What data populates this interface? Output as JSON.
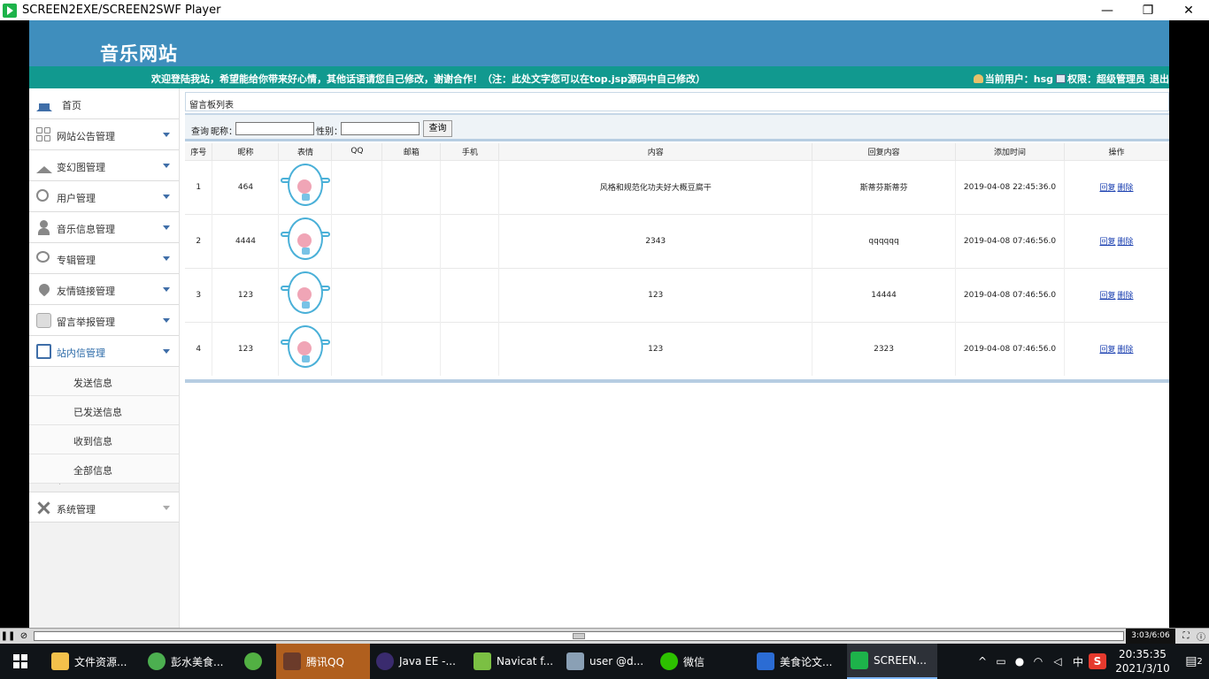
{
  "window": {
    "title": "SCREEN2EXE/SCREEN2SWF Player",
    "minimize_label": "—",
    "restore_label": "❐",
    "close_label": "✕"
  },
  "site": {
    "title": "音乐网站",
    "welcome": "欢迎登陆我站，希望能给你带来好心情，其他话语请您自己修改，谢谢合作！（注：此处文字您可以在top.jsp源码中自己修改）",
    "current_user_label": "当前用户：hsg",
    "permission_label": "权限：超级管理员",
    "logout_label": "退出",
    "header_color": "#3f8ebd",
    "bar_color": "#11998f"
  },
  "sidebar": {
    "items": [
      {
        "label": "首页",
        "icon": "home-icon"
      },
      {
        "label": "网站公告管理",
        "icon": "grid-icon"
      },
      {
        "label": "变幻图管理",
        "icon": "house-icon"
      },
      {
        "label": "用户管理",
        "icon": "users-icon"
      },
      {
        "label": "音乐信息管理",
        "icon": "person-icon"
      },
      {
        "label": "专辑管理",
        "icon": "chat-icon"
      },
      {
        "label": "友情链接管理",
        "icon": "heart-icon"
      },
      {
        "label": "留言举报管理",
        "icon": "group-icon"
      },
      {
        "label": "站内信管理",
        "icon": "doc-icon"
      }
    ],
    "sub_items": [
      {
        "label": "发送信息"
      },
      {
        "label": "已发送信息"
      },
      {
        "label": "收到信息"
      },
      {
        "label": "全部信息"
      }
    ],
    "system": {
      "label": "系统管理",
      "icon": "tools-icon"
    }
  },
  "main": {
    "panel_title": "留言板列表",
    "search": {
      "query_label": "查询",
      "nickname_label": "昵称：",
      "nickname_value": "",
      "gender_label": "性别：",
      "gender_value": "",
      "button_label": "查询"
    },
    "columns": [
      "序号",
      "昵称",
      "表情",
      "QQ",
      "邮箱",
      "手机",
      "内容",
      "回复内容",
      "添加时间",
      "操作"
    ],
    "rows": [
      {
        "no": "1",
        "nickname": "464",
        "qq": "",
        "email": "",
        "phone": "",
        "content": "风格和规范化功夫好大概豆腐干",
        "reply": "斯蒂芬斯蒂芬",
        "time": "2019-04-08 22:45:36.0",
        "reply_link": "回复",
        "delete_link": "删除"
      },
      {
        "no": "2",
        "nickname": "4444",
        "qq": "",
        "email": "",
        "phone": "",
        "content": "2343",
        "reply": "qqqqqq",
        "time": "2019-04-08 07:46:56.0",
        "reply_link": "回复",
        "delete_link": "删除"
      },
      {
        "no": "3",
        "nickname": "123",
        "qq": "",
        "email": "",
        "phone": "",
        "content": "123",
        "reply": "14444",
        "time": "2019-04-08 07:46:56.0",
        "reply_link": "回复",
        "delete_link": "删除"
      },
      {
        "no": "4",
        "nickname": "123",
        "qq": "",
        "email": "",
        "phone": "",
        "content": "123",
        "reply": "2323",
        "time": "2019-04-08 07:46:56.0",
        "reply_link": "回复",
        "delete_link": "删除"
      }
    ]
  },
  "player": {
    "time": "3:03/6:06",
    "progress": 0.5
  },
  "taskbar": {
    "items": [
      {
        "label": "文件资源...",
        "color": "#f3c04b"
      },
      {
        "label": "彭水美食...",
        "color": "#4caf50"
      },
      {
        "label": "",
        "color": "#52b043"
      },
      {
        "label": "腾讯QQ",
        "color": "#6b3b2a"
      },
      {
        "label": "Java EE -...",
        "color": "#3a2b6e"
      },
      {
        "label": "Navicat f...",
        "color": "#7bc043"
      },
      {
        "label": "user @d...",
        "color": "#8aa0b5"
      },
      {
        "label": "微信",
        "color": "#2dc100"
      },
      {
        "label": "美食论文...",
        "color": "#2b6cd4"
      },
      {
        "label": "SCREEN...",
        "color": "#1db34a"
      }
    ],
    "tray_ime": "中",
    "tray_app": "S",
    "clock_time": "20:35:35",
    "clock_date": "2021/3/10",
    "notifications": "2"
  }
}
